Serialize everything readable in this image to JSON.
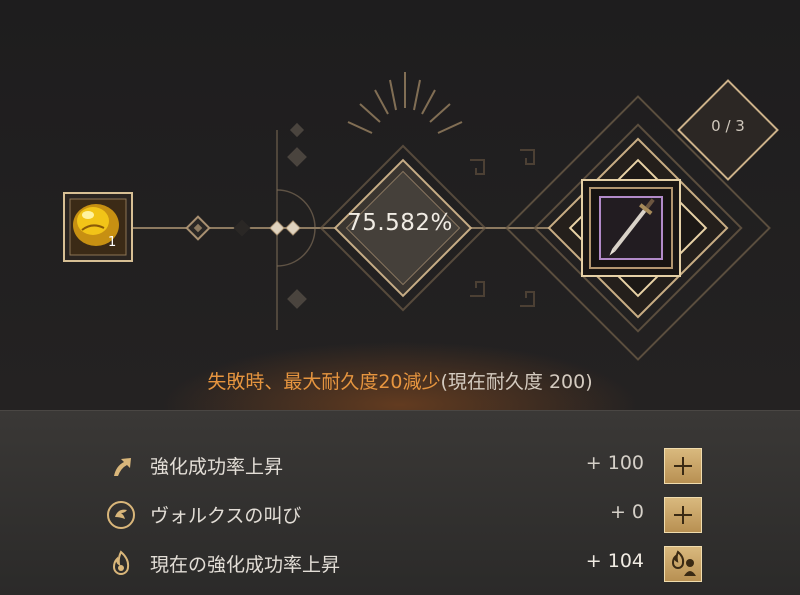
{
  "item": {
    "name": "golden-stone",
    "count": "1"
  },
  "success_rate": "75.582%",
  "stack_counter": "0 / 3",
  "warning": {
    "main": "失敗時、最大耐久度20減少",
    "sub": "(現在耐久度 200)"
  },
  "bonuses": [
    {
      "label": "強化成功率上昇",
      "value": "+ 100",
      "icon": "arrow-up-icon",
      "button": "plus"
    },
    {
      "label": "ヴォルクスの叫び",
      "value": "+ 0",
      "icon": "valks-cry-icon",
      "button": "plus"
    },
    {
      "label": "現在の強化成功率上昇",
      "value": "+ 104",
      "icon": "flame-icon",
      "button": "flame-person"
    }
  ],
  "colors": {
    "accent": "#e6953f",
    "gold": "#c9a46a",
    "button": "#d9b97e"
  }
}
